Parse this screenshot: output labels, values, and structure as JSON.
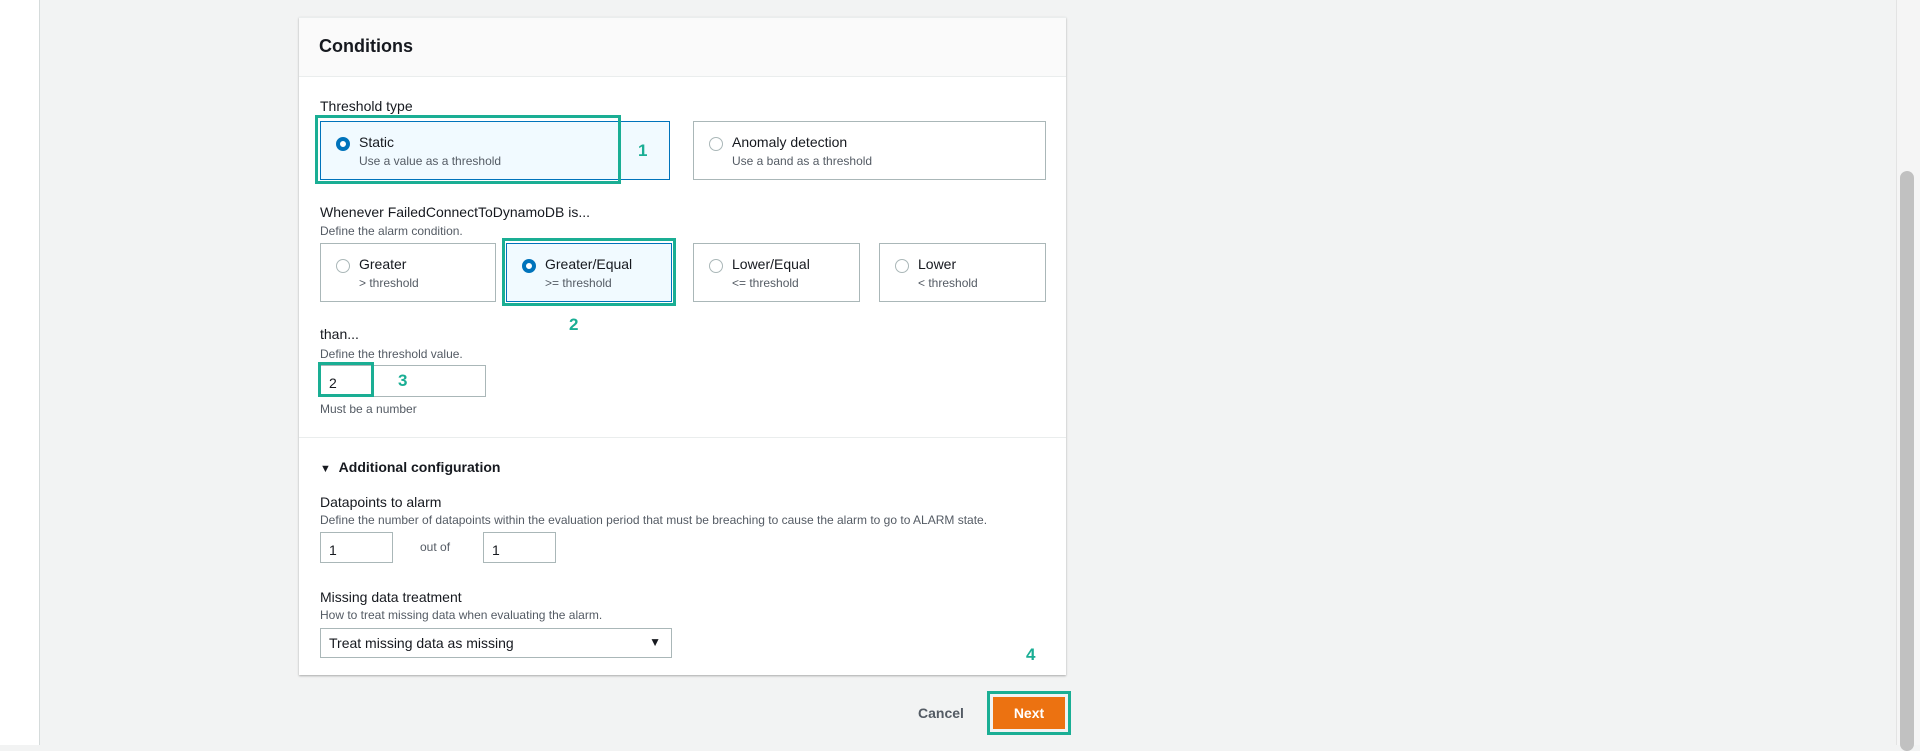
{
  "conditions": {
    "title": "Conditions",
    "threshold_type": {
      "label": "Threshold type",
      "options": [
        {
          "name": "Static",
          "desc": "Use a value as a threshold",
          "selected": true
        },
        {
          "name": "Anomaly detection",
          "desc": "Use a band as a threshold",
          "selected": false
        }
      ]
    },
    "whenever": {
      "label": "Whenever FailedConnectToDynamoDB is...",
      "desc": "Define the alarm condition.",
      "options": [
        {
          "name": "Greater",
          "desc": "> threshold",
          "selected": false
        },
        {
          "name": "Greater/Equal",
          "desc": ">= threshold",
          "selected": true
        },
        {
          "name": "Lower/Equal",
          "desc": "<= threshold",
          "selected": false
        },
        {
          "name": "Lower",
          "desc": "< threshold",
          "selected": false
        }
      ]
    },
    "than": {
      "label": "than...",
      "desc": "Define the threshold value.",
      "value": "2",
      "hint": "Must be a number"
    }
  },
  "additional": {
    "toggle_label": "Additional configuration",
    "datapoints": {
      "label": "Datapoints to alarm",
      "desc": "Define the number of datapoints within the evaluation period that must be breaching to cause the alarm to go to ALARM state.",
      "value1": "1",
      "out_of": "out of",
      "value2": "1"
    },
    "missing": {
      "label": "Missing data treatment",
      "desc": "How to treat missing data when evaluating the alarm.",
      "value": "Treat missing data as missing"
    }
  },
  "footer": {
    "cancel": "Cancel",
    "next": "Next"
  },
  "annotations": [
    "1",
    "2",
    "3",
    "4"
  ],
  "colors": {
    "highlight": "#1aae94",
    "primary": "#ec7211",
    "selected": "#0073bb"
  }
}
